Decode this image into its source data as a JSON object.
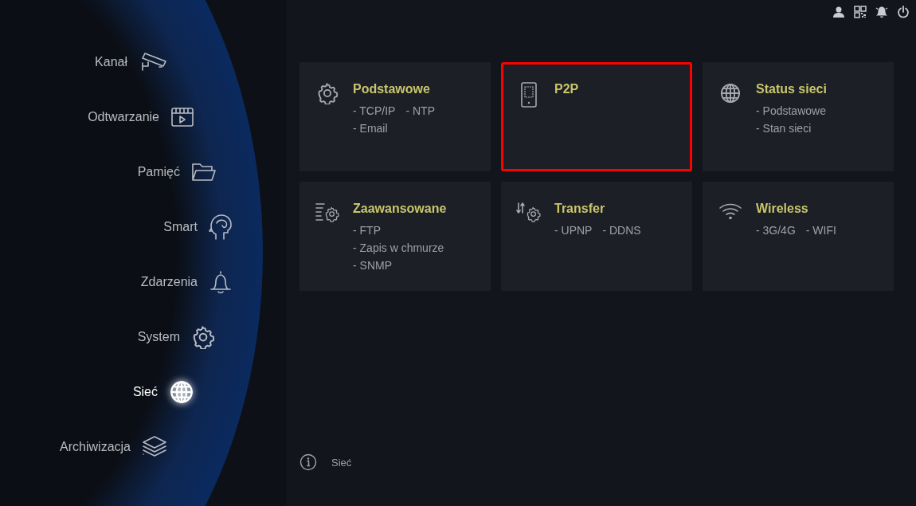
{
  "sidebar": {
    "items": [
      {
        "label": "Kanał",
        "selected": false
      },
      {
        "label": "Odtwarzanie",
        "selected": false
      },
      {
        "label": "Pamięć",
        "selected": false
      },
      {
        "label": "Smart",
        "selected": false
      },
      {
        "label": "Zdarzenia",
        "selected": false
      },
      {
        "label": "System",
        "selected": false
      },
      {
        "label": "Sieć",
        "selected": true
      },
      {
        "label": "Archiwizacja",
        "selected": false
      }
    ]
  },
  "tiles": [
    {
      "title": "Podstawowe",
      "highlighted": false,
      "lines": [
        [
          "- TCP/IP",
          "- NTP"
        ],
        [
          "- Email"
        ]
      ]
    },
    {
      "title": "P2P",
      "highlighted": true
    },
    {
      "title": "Status sieci",
      "highlighted": false,
      "lines": [
        [
          "- Podstawowe"
        ],
        [
          "- Stan sieci"
        ]
      ]
    },
    {
      "title": "Zaawansowane",
      "highlighted": false,
      "lines": [
        [
          "- FTP"
        ],
        [
          "- Zapis w chmurze"
        ],
        [
          "- SNMP"
        ]
      ]
    },
    {
      "title": "Transfer",
      "highlighted": false,
      "lines": [
        [
          "- UPNP",
          "- DDNS"
        ]
      ]
    },
    {
      "title": "Wireless",
      "highlighted": false,
      "lines": [
        [
          "- 3G/4G",
          "- WIFI"
        ]
      ]
    }
  ],
  "footer": {
    "text": "Sieć"
  }
}
